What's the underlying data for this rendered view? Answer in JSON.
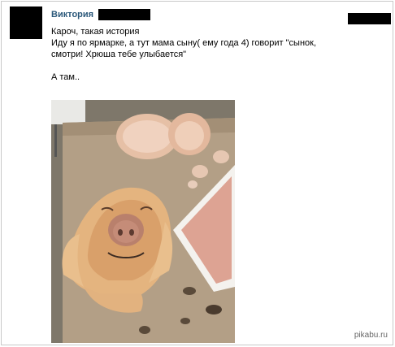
{
  "post": {
    "author_name": "Виктория",
    "lines": [
      "Кароч, такая история",
      "Иду я по ярмарке, а тут мама сыну( ему года 4) говорит \"сынок,",
      "смотри! Хрюша тебе улыбается\"",
      "А там.."
    ]
  },
  "photo": {
    "subject": "pig-head-on-market-table"
  },
  "watermark": {
    "text": "pikabu.ru"
  },
  "colors": {
    "author": "#2b587a",
    "border": "#c8c8c8",
    "redaction": "#000000"
  }
}
